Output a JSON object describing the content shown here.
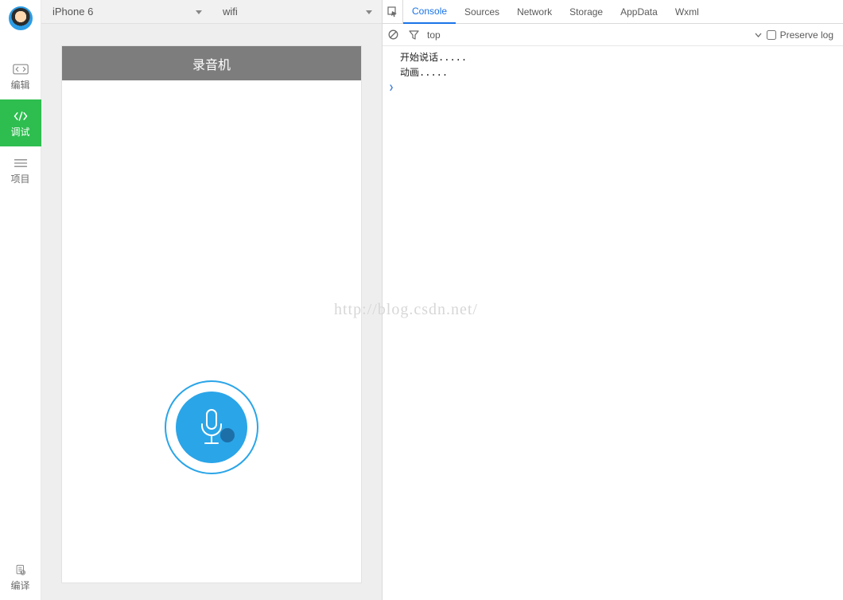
{
  "sidebar": {
    "items": [
      {
        "label": "编辑"
      },
      {
        "label": "调试"
      },
      {
        "label": "项目"
      }
    ],
    "compile_label": "编译"
  },
  "simbar": {
    "device": "iPhone 6",
    "network": "wifi"
  },
  "phone": {
    "title": "录音机"
  },
  "devtools": {
    "tabs": [
      {
        "label": "Console",
        "active": true
      },
      {
        "label": "Sources"
      },
      {
        "label": "Network"
      },
      {
        "label": "Storage"
      },
      {
        "label": "AppData"
      },
      {
        "label": "Wxml"
      }
    ],
    "context": "top",
    "preserve_log_label": "Preserve log",
    "log_lines": [
      "开始说话.....",
      "动画....."
    ]
  },
  "watermark": "http://blog.csdn.net/"
}
